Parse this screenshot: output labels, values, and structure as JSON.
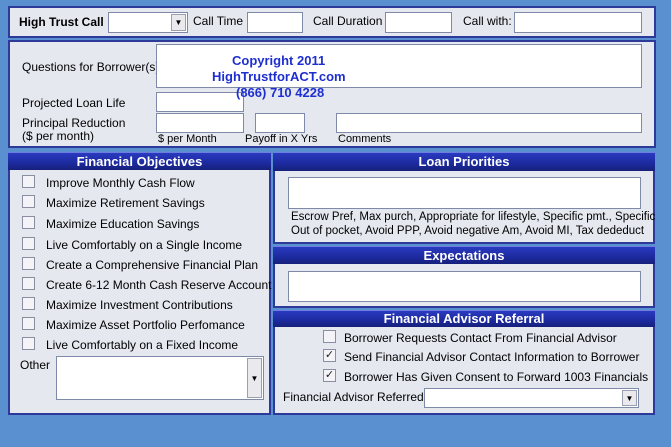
{
  "header": {
    "title": "High Trust Call",
    "call_time_label": "Call Time",
    "call_duration_label": "Call Duration",
    "call_with_label": "Call with:"
  },
  "questions": {
    "questions_label": "Questions for Borrower(s)",
    "projected_loan_life_label": "Projected Loan Life",
    "principal_reduction_label": "Principal Reduction",
    "principal_reduction_sub": "($ per month)",
    "per_month_label": "$ per Month",
    "payoff_label": "Payoff in X Yrs",
    "comments_label": "Comments"
  },
  "copyright": {
    "line1": "Copyright 2011",
    "line2": "HighTrustforACT.com",
    "line3": "(866) 710 4228"
  },
  "financial_objectives": {
    "title": "Financial Objectives",
    "items": [
      {
        "label": "Improve Monthly Cash Flow",
        "checked": false
      },
      {
        "label": "Maximize Retirement Savings",
        "checked": false
      },
      {
        "label": "Maximize Education Savings",
        "checked": false
      },
      {
        "label": "Live Comfortably on a Single Income",
        "checked": false
      },
      {
        "label": "Create a Comprehensive Financial Plan",
        "checked": false
      },
      {
        "label": "Create 6-12 Month Cash Reserve Account",
        "checked": false
      },
      {
        "label": "Maximize Investment Contributions",
        "checked": false
      },
      {
        "label": "Maximize Asset Portfolio Perfomance",
        "checked": false
      },
      {
        "label": "Live Comfortably on a Fixed Income",
        "checked": false
      }
    ],
    "other_label": "Other"
  },
  "loan_priorities": {
    "title": "Loan Priorities",
    "hint_line1": "Escrow Pref, Max purch, Appropriate for lifestyle, Specific pmt., Specific",
    "hint_line2": "Out of pocket, Avoid PPP, Avoid negative Am, Avoid MI, Tax dededuct"
  },
  "expectations": {
    "title": "Expectations"
  },
  "advisor_referral": {
    "title": "Financial Advisor Referral",
    "items": [
      {
        "label": "Borrower Requests Contact From Financial Advisor",
        "checked": false
      },
      {
        "label": "Send Financial Advisor Contact Information to Borrower",
        "checked": true
      },
      {
        "label": "Borrower Has Given Consent to Forward 1003  Financials",
        "checked": true
      }
    ],
    "referred_label": "Financial  Advisor Referred:"
  },
  "icons": {
    "dropdown": "▼",
    "check": "✓"
  }
}
